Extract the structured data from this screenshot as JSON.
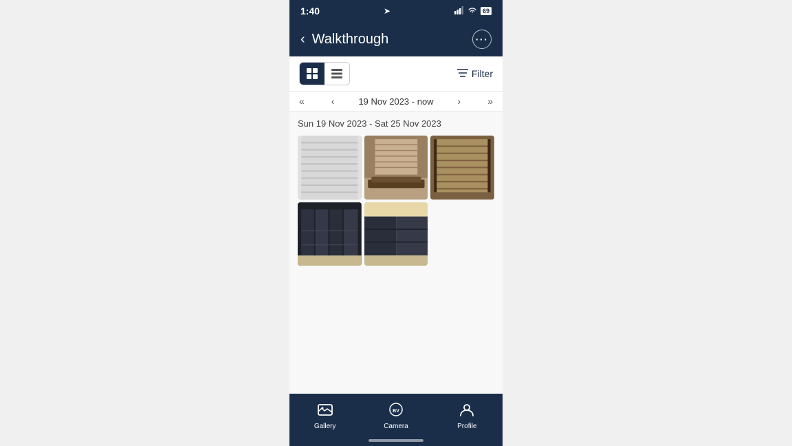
{
  "statusBar": {
    "time": "1:40",
    "battery": "69"
  },
  "header": {
    "title": "Walkthrough",
    "backLabel": "‹",
    "moreLabel": "•••"
  },
  "toolbar": {
    "filterLabel": "Filter",
    "viewGridActive": true
  },
  "dateNav": {
    "label": "19 Nov 2023 - now"
  },
  "gallery": {
    "dateRange": "Sun 19 Nov 2023 - Sat 25 Nov 2023",
    "photos": [
      {
        "id": "photo1",
        "color1": "#d6d6d6",
        "color2": "#c0c0c0"
      },
      {
        "id": "photo2",
        "color1": "#4a3c2c",
        "color2": "#6b5a3e"
      },
      {
        "id": "photo3",
        "color1": "#5a4a32",
        "color2": "#7a6040"
      },
      {
        "id": "photo4",
        "color1": "#2a2e3a",
        "color2": "#3a3e4e"
      },
      {
        "id": "photo5",
        "color1": "#7a6840",
        "color2": "#9a8850"
      }
    ]
  },
  "bottomTabs": [
    {
      "id": "gallery",
      "label": "Gallery",
      "active": true
    },
    {
      "id": "camera",
      "label": "Camera",
      "active": false
    },
    {
      "id": "profile",
      "label": "Profile",
      "active": false
    }
  ]
}
